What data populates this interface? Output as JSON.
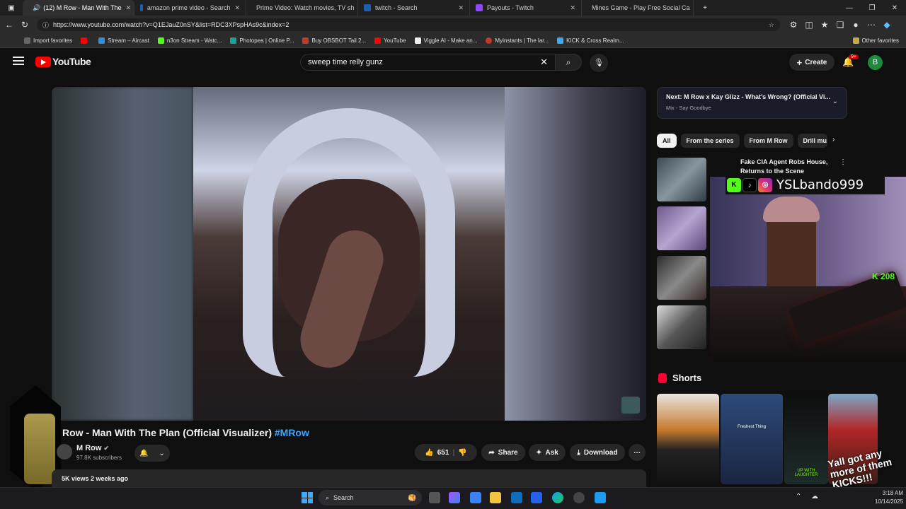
{
  "browser": {
    "tabs": [
      {
        "title": "(12) M Row - Man With The",
        "active": true
      },
      {
        "title": "amazon prime video - Search"
      },
      {
        "title": "Prime Video: Watch movies, TV sh"
      },
      {
        "title": "twitch - Search"
      },
      {
        "title": "Payouts - Twitch"
      },
      {
        "title": "Mines Game - Play Free Social Ca"
      }
    ],
    "url": "https://www.youtube.com/watch?v=Q1EJauZ0nSY&list=RDC3XPspHAs9c&index=2",
    "bookmarks": [
      "Import favorites",
      "Stream – Aircast",
      "n3on Stream - Watc...",
      "Photopea | Online P...",
      "Buy OBSBOT Tail 2...",
      "YouTube",
      "Viggle AI - Make an...",
      "Myinstants | The lar...",
      "KICK & Cross Realm..."
    ],
    "other_favorites": "Other favorites"
  },
  "youtube": {
    "logo_text": "YouTube",
    "search_value": "sweep time relly gunz",
    "create_label": "Create",
    "notif_badge": "9+",
    "avatar_letter": "B"
  },
  "video": {
    "title": "Row - Man With The Plan (Official Visualizer)",
    "hashtag": "#MRow",
    "channel": "M Row",
    "subscribers": "97.8K subscribers",
    "likes": "651",
    "share": "Share",
    "ask": "Ask",
    "download": "Download",
    "views_date": "5K views  2 weeks ago"
  },
  "sidebar": {
    "next_label": "Next:",
    "next_title": "M Row x Kay Glizz - What's Wrong? (Official Vi...",
    "next_sub": "Mix - Say Goodbye",
    "chips": [
      "All",
      "From the series",
      "From M Row",
      "Drill mu"
    ],
    "rec1_title": "Fake CIA Agent Robs House, Returns to the Scene"
  },
  "overlay": {
    "handle": "YSLbando999",
    "kick_count": "208"
  },
  "shorts": {
    "heading": "Shorts",
    "short2_caption": "Freshest Thing",
    "short3_caption": "UP WITH LAUGHTER",
    "short4_caption": "Yall got any more of them KICKS!!!"
  },
  "taskbar": {
    "search_label": "Search",
    "time": "3:18 AM",
    "date": "10/14/2025"
  }
}
